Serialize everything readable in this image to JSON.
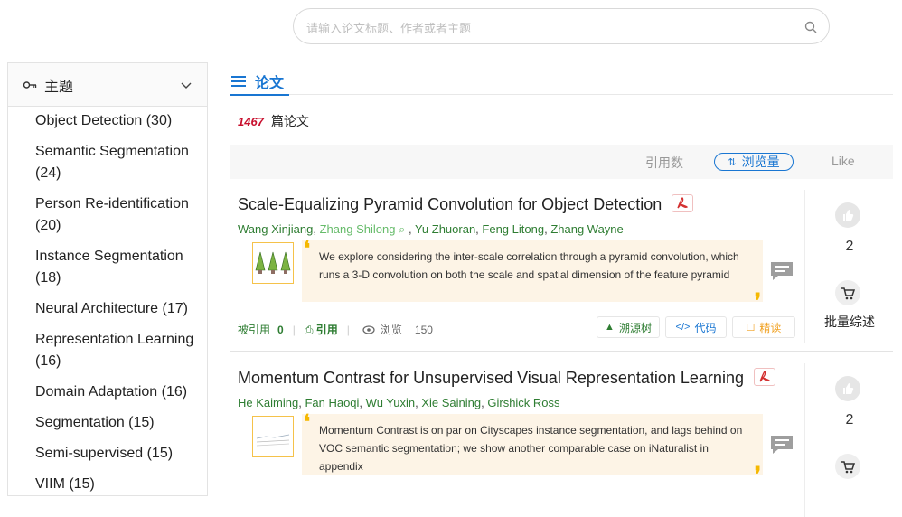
{
  "search": {
    "placeholder": "请输入论文标题、作者或者主题"
  },
  "sidebar": {
    "title": "主题",
    "items": [
      "Object Detection (30)",
      "Semantic Segmentation (24)",
      "Person Re-identification (20)",
      "Instance Segmentation (18)",
      "Neural Architecture (17)",
      "Representation Learning (16)",
      "Domain Adaptation (16)",
      "Segmentation (15)",
      "Semi-supervised (15)",
      "VIIM (15)"
    ]
  },
  "tabs": {
    "papers": "论文"
  },
  "results": {
    "count": "1467",
    "suffix": "篇论文"
  },
  "sort": {
    "citations": "引用数",
    "views": "浏览量",
    "like": "Like"
  },
  "papers": [
    {
      "title": "Scale-Equalizing Pyramid Convolution for Object Detection",
      "authors": [
        "Wang Xinjiang",
        "Zhang Shilong",
        "Yu Zhuoran",
        "Feng Litong",
        "Zhang Wayne"
      ],
      "abstract": "We explore considering the inter-scale correlation through a pyramid convolution, which runs a 3-D convolution on both the scale and spatial dimension of the feature pyramid",
      "cited_label": "被引用",
      "cited_count": "0",
      "cite_label": "引用",
      "view_label": "浏览",
      "view_count": "150",
      "buttons": {
        "tree": "溯源树",
        "code": "代码",
        "read": "精读"
      },
      "likes": "2",
      "batch_label": "批量综述"
    },
    {
      "title": "Momentum Contrast for Unsupervised Visual Representation Learning",
      "authors": [
        "He Kaiming",
        "Fan Haoqi",
        "Wu Yuxin",
        "Xie Saining",
        "Girshick Ross"
      ],
      "abstract": "Momentum Contrast is on par on Cityscapes instance segmentation, and lags behind on VOC semantic segmentation; we show another comparable case on iNaturalist in appendix",
      "likes": "2"
    }
  ],
  "colors": {
    "accent": "#1976d2",
    "author_green": "#2e7d32",
    "count_red": "#c8102e",
    "abstract_bg": "#fdf4e6",
    "quote": "#f5b800"
  }
}
